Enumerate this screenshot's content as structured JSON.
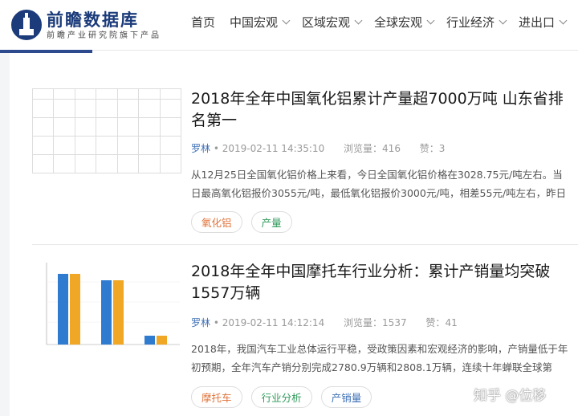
{
  "logo": {
    "title": "前瞻数据库",
    "subtitle": "前瞻产业研究院旗下产品"
  },
  "nav": [
    {
      "label": "首页",
      "dropdown": false
    },
    {
      "label": "中国宏观",
      "dropdown": true
    },
    {
      "label": "区域宏观",
      "dropdown": true
    },
    {
      "label": "全球宏观",
      "dropdown": true
    },
    {
      "label": "行业经济",
      "dropdown": true
    },
    {
      "label": "进出口",
      "dropdown": true
    }
  ],
  "articles": [
    {
      "title": "2018年全年中国氧化铝累计产量超7000万吨 山东省排名第一",
      "author": "罗林",
      "date": "2019-02-11 14:35:10",
      "views_label": "浏览量：",
      "views": "416",
      "likes_label": "赞：",
      "likes": "3",
      "excerpt": "从12月25日全国氧化铝价格上来看，今日全国氧化铝价格在3028.75元/吨左右。当日最高氧化铝报价3055元/吨，最低氧化铝报价3000元/吨，相差55元/吨左右，昨日",
      "tags": [
        "氧化铝",
        "产量"
      ]
    },
    {
      "title": "2018年全年中国摩托车行业分析：累计产销量均突破1557万辆",
      "author": "罗林",
      "date": "2019-02-11 14:12:14",
      "views_label": "浏览量：",
      "views": "1537",
      "likes_label": "赞：",
      "likes": "41",
      "excerpt": "2018年，我国汽车工业总体运行平稳，受政策因素和宏观经济的影响，产销量低于年初预期，全年汽车产销分别完成2780.9万辆和2808.1万辆，连续十年蝉联全球第",
      "tags": [
        "摩托车",
        "行业分析",
        "产销量"
      ]
    }
  ],
  "watermark": "知乎 @位移",
  "colors": {
    "brand": "#1b3b7a",
    "accent": "#2e4a8f",
    "author": "#3d6fb6",
    "bar_blue": "#2f7bd0",
    "bar_orange": "#f0a726"
  }
}
